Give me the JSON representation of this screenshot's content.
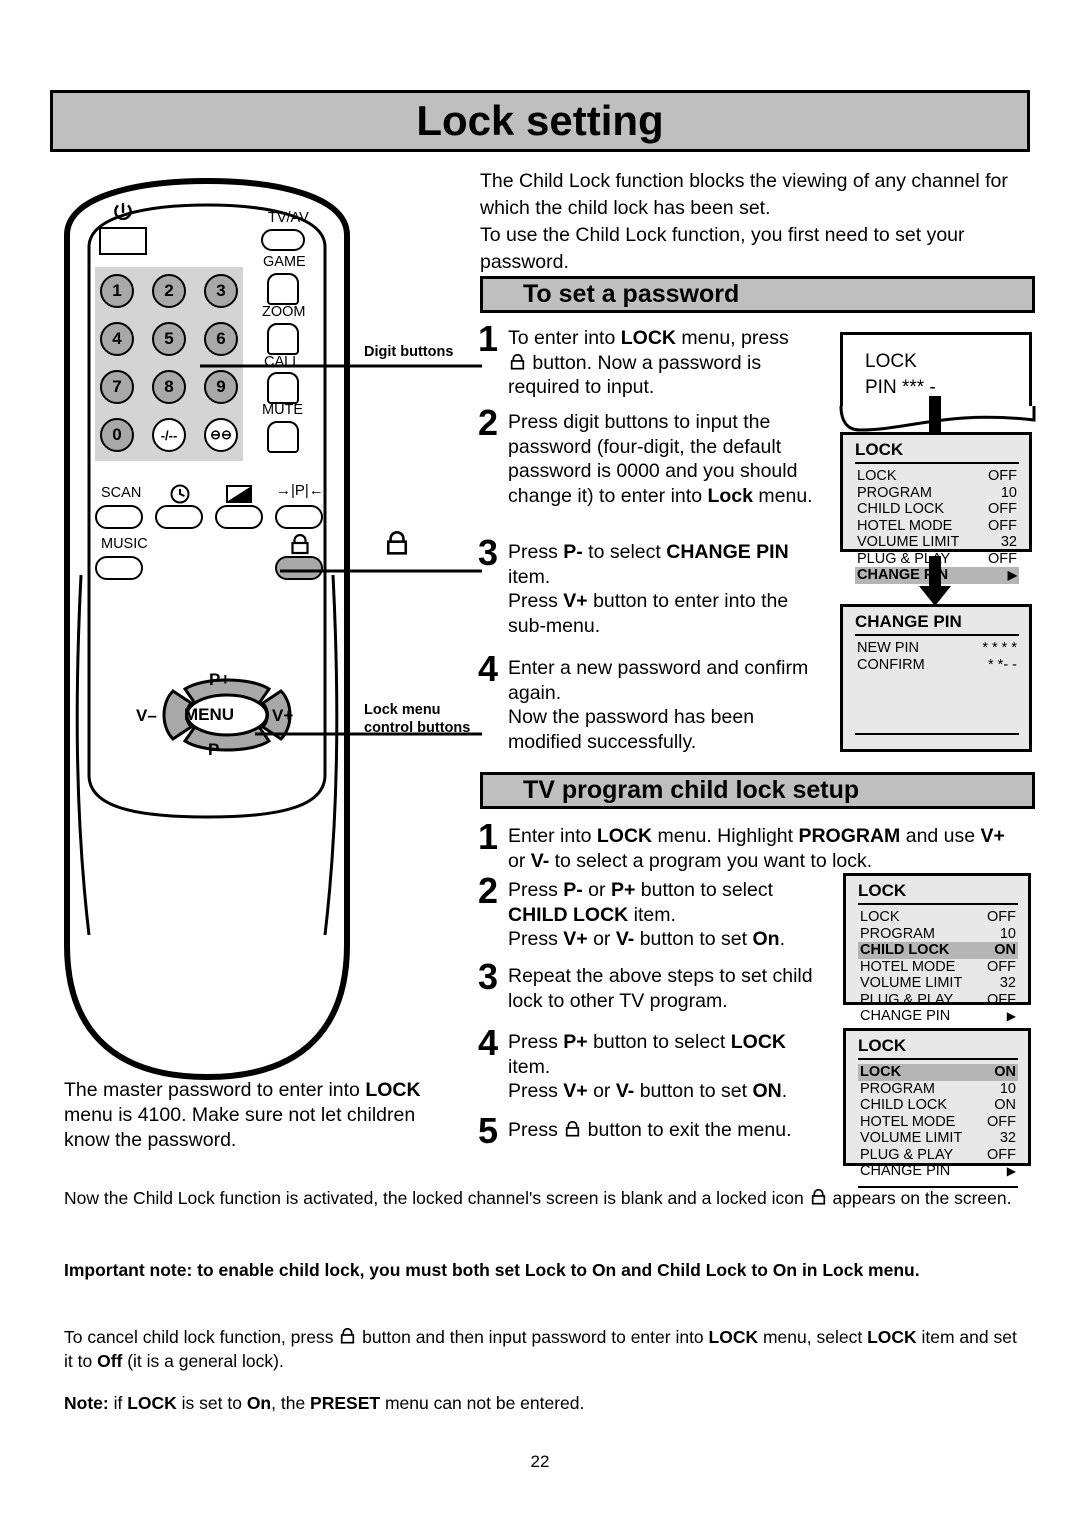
{
  "page": {
    "title": "Lock setting",
    "number": "22"
  },
  "intro": {
    "line1": "The Child Lock function blocks the viewing of any channel for",
    "line2": "which the child lock has been set.",
    "line3": "To use the Child Lock function, you first need to set your",
    "line4": "password."
  },
  "sections": {
    "password": {
      "heading": "To set a password",
      "steps": [
        {
          "num": "1",
          "parts": [
            {
              "t": "To enter into ",
              "b": false
            },
            {
              "t": "LOCK",
              "b": true
            },
            {
              "t": " menu, press",
              "b": false
            },
            {
              "t": "\n",
              "b": false
            },
            {
              "t": "ICON_LOCK",
              "b": false
            },
            {
              "t": " button. Now a password is required to input.",
              "b": false
            }
          ]
        },
        {
          "num": "2",
          "parts": [
            {
              "t": "Press digit buttons to input the password (four-digit, the default password is 0000 and you should change it) to enter into ",
              "b": false
            },
            {
              "t": "Lock",
              "b": true
            },
            {
              "t": " menu.",
              "b": false
            }
          ]
        },
        {
          "num": "3",
          "parts": [
            {
              "t": "Press ",
              "b": false
            },
            {
              "t": "P-",
              "b": true
            },
            {
              "t": " to select ",
              "b": false
            },
            {
              "t": "CHANGE PIN",
              "b": true
            },
            {
              "t": " item.",
              "b": false
            },
            {
              "t": "\n",
              "b": false
            },
            {
              "t": "Press ",
              "b": false
            },
            {
              "t": "V+",
              "b": true
            },
            {
              "t": " button to enter into the sub-menu.",
              "b": false
            }
          ]
        },
        {
          "num": "4",
          "parts": [
            {
              "t": "Enter a new password and confirm again.",
              "b": false
            },
            {
              "t": "\n",
              "b": false
            },
            {
              "t": "Now the password has been modified successfully.",
              "b": false
            }
          ]
        }
      ]
    },
    "childlock": {
      "heading": "TV program child lock setup",
      "steps": [
        {
          "num": "1",
          "parts": [
            {
              "t": "Enter into ",
              "b": false
            },
            {
              "t": "LOCK",
              "b": true
            },
            {
              "t": " menu. Highlight ",
              "b": false
            },
            {
              "t": "PROGRAM",
              "b": true
            },
            {
              "t": " and use ",
              "b": false
            },
            {
              "t": "V+",
              "b": true
            },
            {
              "t": " or ",
              "b": false
            },
            {
              "t": "V-",
              "b": true
            },
            {
              "t": " to select a program you want to lock.",
              "b": false
            }
          ]
        },
        {
          "num": "2",
          "parts": [
            {
              "t": "Press ",
              "b": false
            },
            {
              "t": "P-",
              "b": true
            },
            {
              "t": " or ",
              "b": false
            },
            {
              "t": "P+",
              "b": true
            },
            {
              "t": " button to select ",
              "b": false
            },
            {
              "t": "CHILD LOCK",
              "b": true
            },
            {
              "t": " item.",
              "b": false
            },
            {
              "t": "\n",
              "b": false
            },
            {
              "t": "Press ",
              "b": false
            },
            {
              "t": "V+",
              "b": true
            },
            {
              "t": " or ",
              "b": false
            },
            {
              "t": "V-",
              "b": true
            },
            {
              "t": " button to set ",
              "b": false
            },
            {
              "t": "On",
              "b": true
            },
            {
              "t": ".",
              "b": false
            }
          ]
        },
        {
          "num": "3",
          "parts": [
            {
              "t": "Repeat the above steps to set child lock to other TV program.",
              "b": false
            }
          ]
        },
        {
          "num": "4",
          "parts": [
            {
              "t": "Press ",
              "b": false
            },
            {
              "t": "P+",
              "b": true
            },
            {
              "t": " button to select ",
              "b": false
            },
            {
              "t": "LOCK",
              "b": true
            },
            {
              "t": " item.",
              "b": false
            },
            {
              "t": "\n",
              "b": false
            },
            {
              "t": "Press ",
              "b": false
            },
            {
              "t": "V+",
              "b": true
            },
            {
              "t": " or ",
              "b": false
            },
            {
              "t": "V-",
              "b": true
            },
            {
              "t": " button to set ",
              "b": false
            },
            {
              "t": "ON",
              "b": true
            },
            {
              "t": ".",
              "b": false
            }
          ]
        },
        {
          "num": "5",
          "parts": [
            {
              "t": "Press ",
              "b": false
            },
            {
              "t": "ICON_LOCK",
              "b": false
            },
            {
              "t": " button to exit the menu.",
              "b": false
            }
          ]
        }
      ]
    }
  },
  "osd": {
    "pin_prompt": {
      "line1": "LOCK",
      "line2": "PIN *** -"
    },
    "lock_menu_1": {
      "title": "LOCK",
      "rows": [
        {
          "label": "LOCK",
          "value": "OFF",
          "selected": false
        },
        {
          "label": "PROGRAM",
          "value": "10",
          "selected": false
        },
        {
          "label": "CHILD LOCK",
          "value": "OFF",
          "selected": false
        },
        {
          "label": "HOTEL MODE",
          "value": "OFF",
          "selected": false
        },
        {
          "label": "VOLUME LIMIT",
          "value": "32",
          "selected": false
        },
        {
          "label": "PLUG & PLAY",
          "value": "OFF",
          "selected": false
        },
        {
          "label": "CHANGE PIN",
          "value": "▶",
          "selected": true
        }
      ]
    },
    "change_pin_menu": {
      "title": "CHANGE PIN",
      "rows": [
        {
          "label": "NEW PIN",
          "value": "* * * *",
          "selected": false
        },
        {
          "label": "CONFIRM",
          "value": "* *- -",
          "selected": false
        }
      ]
    },
    "lock_menu_2": {
      "title": "LOCK",
      "rows": [
        {
          "label": "LOCK",
          "value": "OFF",
          "selected": false
        },
        {
          "label": "PROGRAM",
          "value": "10",
          "selected": false
        },
        {
          "label": "CHILD LOCK",
          "value": "ON",
          "selected": true
        },
        {
          "label": "HOTEL MODE",
          "value": "OFF",
          "selected": false
        },
        {
          "label": "VOLUME LIMIT",
          "value": "32",
          "selected": false
        },
        {
          "label": "PLUG & PLAY",
          "value": "OFF",
          "selected": false
        },
        {
          "label": "CHANGE PIN",
          "value": "▶",
          "selected": false
        }
      ]
    },
    "lock_menu_3": {
      "title": "LOCK",
      "rows": [
        {
          "label": "LOCK",
          "value": "ON",
          "selected": true
        },
        {
          "label": "PROGRAM",
          "value": "10",
          "selected": false
        },
        {
          "label": "CHILD LOCK",
          "value": "ON",
          "selected": false
        },
        {
          "label": "HOTEL MODE",
          "value": "OFF",
          "selected": false
        },
        {
          "label": "VOLUME LIMIT",
          "value": "32",
          "selected": false
        },
        {
          "label": "PLUG & PLAY",
          "value": "OFF",
          "selected": false
        },
        {
          "label": "CHANGE PIN",
          "value": "▶",
          "selected": false
        }
      ]
    }
  },
  "remote": {
    "callouts": {
      "digit_buttons": "Digit buttons",
      "lock_menu_line1": "Lock menu",
      "lock_menu_line2": "control buttons"
    },
    "digit_keys": [
      {
        "label": "1",
        "white": false
      },
      {
        "label": "2",
        "white": false
      },
      {
        "label": "3",
        "white": false
      },
      {
        "label": "4",
        "white": false
      },
      {
        "label": "5",
        "white": false
      },
      {
        "label": "6",
        "white": false
      },
      {
        "label": "7",
        "white": false
      },
      {
        "label": "8",
        "white": false
      },
      {
        "label": "9",
        "white": false
      },
      {
        "label": "0",
        "white": false
      },
      {
        "label": "-/--",
        "white": true
      },
      {
        "label": "⊖⊖",
        "white": true
      }
    ],
    "right_keys": [
      "TV/AV",
      "GAME",
      "ZOOM",
      "CALL",
      "MUTE"
    ],
    "bottom_keys": [
      "SCAN",
      "MUSIC"
    ],
    "function_labels": {
      "timer": "clock-icon",
      "picture": "picture-icon",
      "pip": "→|P|←"
    },
    "pad": {
      "up": "P+",
      "down": "P –",
      "left": "V–",
      "right": "V+",
      "center": "MENU"
    }
  },
  "notes": {
    "master_password": {
      "parts": [
        {
          "t": "The master password to enter into ",
          "b": false
        },
        {
          "t": "LOCK",
          "b": true
        },
        {
          "t": " menu is 4100. Make sure not let children know the password.",
          "b": false
        }
      ]
    },
    "activated": {
      "parts": [
        {
          "t": "Now the Child Lock function is activated, the locked channel's screen is blank and a locked icon ",
          "b": false
        },
        {
          "t": "ICON_LOCK",
          "b": false
        },
        {
          "t": " appears on the screen.",
          "b": false
        }
      ]
    },
    "important": {
      "parts": [
        {
          "t": "Important note: to enable child lock, you must both set Lock to On and Child Lock to On in Lock menu.",
          "b": true
        }
      ]
    },
    "cancel": {
      "parts": [
        {
          "t": "To cancel child lock function, press ",
          "b": false
        },
        {
          "t": "ICON_LOCK",
          "b": false
        },
        {
          "t": " button and then input password to enter into ",
          "b": false
        },
        {
          "t": "LOCK",
          "b": true
        },
        {
          "t": " menu, select ",
          "b": false
        },
        {
          "t": "LOCK",
          "b": true
        },
        {
          "t": " item and set it to ",
          "b": false
        },
        {
          "t": "Off",
          "b": true
        },
        {
          "t": " (it is a general lock).",
          "b": false
        }
      ]
    },
    "preset": {
      "parts": [
        {
          "t": "Note:",
          "b": true
        },
        {
          "t": " if ",
          "b": false
        },
        {
          "t": "LOCK",
          "b": true
        },
        {
          "t": " is set to ",
          "b": false
        },
        {
          "t": "On",
          "b": true
        },
        {
          "t": ", the ",
          "b": false
        },
        {
          "t": "PRESET",
          "b": true
        },
        {
          "t": " menu can not be entered.",
          "b": false
        }
      ]
    }
  },
  "colors": {
    "banner_gray": "#bfbfbf",
    "osd_bg": "#e8e8e8",
    "osd_highlight": "#b5b5b5",
    "key_gray": "#a8a8a8",
    "keypad_bg": "#d4d4d4"
  }
}
